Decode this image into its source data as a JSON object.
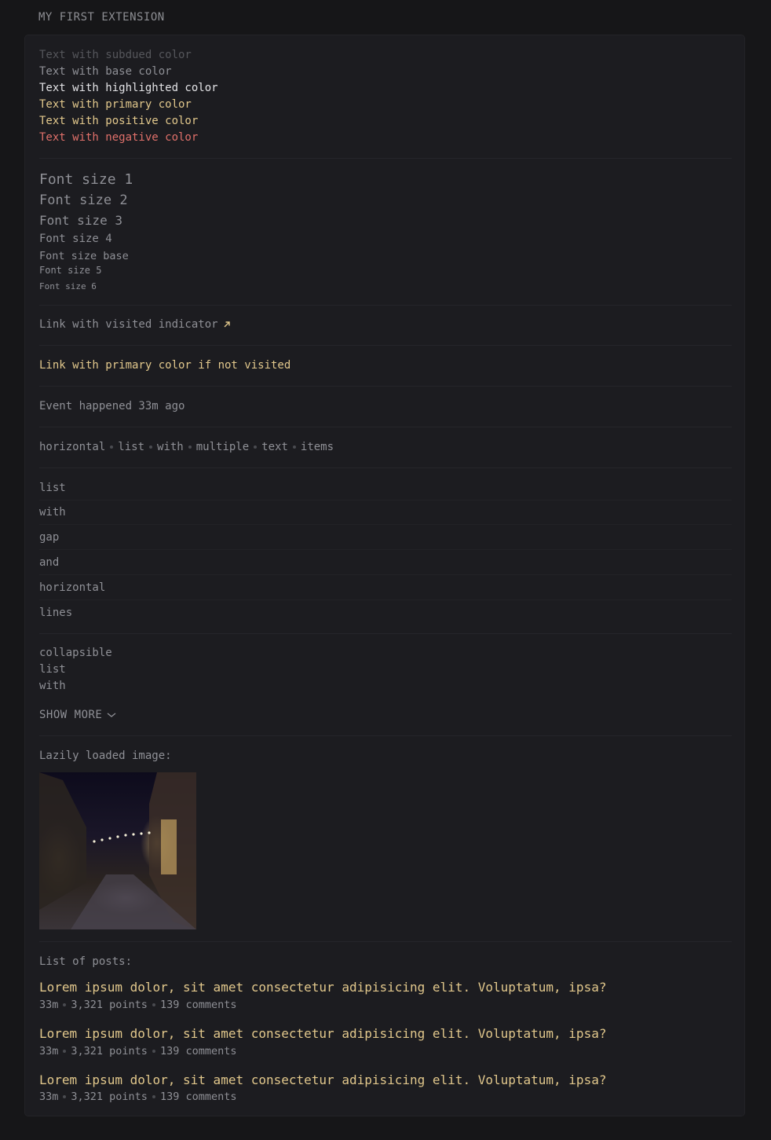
{
  "header": {
    "title": "MY FIRST EXTENSION"
  },
  "colors_section": {
    "subdued": "Text with subdued color",
    "base": "Text with base color",
    "highlighted": "Text with highlighted color",
    "primary": "Text with primary color",
    "positive": "Text with positive color",
    "negative": "Text with negative color"
  },
  "sizes_section": {
    "size1": "Font size 1",
    "size2": "Font size 2",
    "size3": "Font size 3",
    "size4": "Font size 4",
    "sizebase": "Font size base",
    "size5": "Font size 5",
    "size6": "Font size 6"
  },
  "links": {
    "visited": "Link with visited indicator",
    "visited_icon": "arrow-up-right-icon",
    "primary": "Link with primary color if not visited"
  },
  "event": {
    "text": "Event happened 33m ago"
  },
  "horizontal_list": [
    "horizontal",
    "list",
    "with",
    "multiple",
    "text",
    "items"
  ],
  "vertical_list": [
    "list",
    "with",
    "gap",
    "and",
    "horizontal",
    "lines"
  ],
  "collapsible": {
    "items": [
      "collapsible",
      "list",
      "with"
    ],
    "toggle_label": "SHOW MORE",
    "toggle_icon": "chevron-down-icon"
  },
  "image_section": {
    "label": "Lazily loaded image:"
  },
  "posts": {
    "label": "List of posts:",
    "items": [
      {
        "title": "Lorem ipsum dolor, sit amet consectetur adipisicing elit. Voluptatum, ipsa?",
        "age": "33m",
        "points": "3,321 points",
        "comments": "139 comments"
      },
      {
        "title": "Lorem ipsum dolor, sit amet consectetur adipisicing elit. Voluptatum, ipsa?",
        "age": "33m",
        "points": "3,321 points",
        "comments": "139 comments"
      },
      {
        "title": "Lorem ipsum dolor, sit amet consectetur adipisicing elit. Voluptatum, ipsa?",
        "age": "33m",
        "points": "3,321 points",
        "comments": "139 comments"
      }
    ]
  },
  "theme": {
    "background": "#161618",
    "card": "#1c1c20",
    "primary": "#e2c88c",
    "negative": "#e0706a",
    "highlight": "#e3e3e6"
  }
}
